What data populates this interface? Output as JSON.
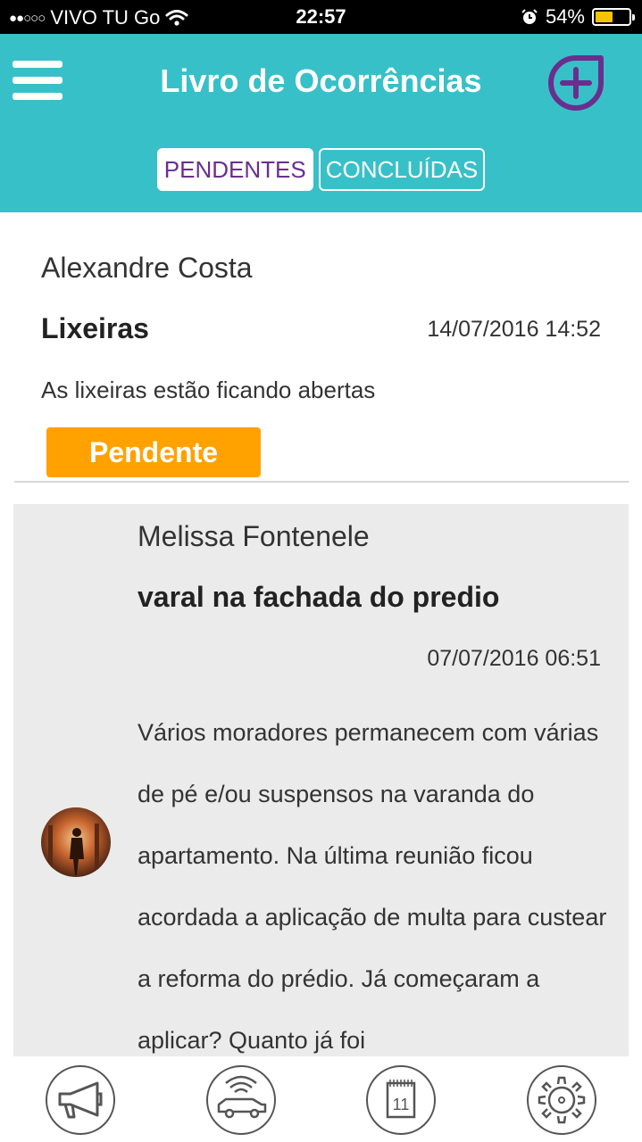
{
  "status_bar": {
    "signal": "●●○○○",
    "carrier": "VIVO TU Go",
    "time": "22:57",
    "battery_percent": "54%",
    "battery_level": 0.54
  },
  "header": {
    "title": "Livro de Ocorrências",
    "tabs": [
      {
        "label": "PENDENTES",
        "active": true
      },
      {
        "label": "CONCLUÍDAS",
        "active": false
      }
    ]
  },
  "occurrences": [
    {
      "author": "Alexandre Costa",
      "subject": "Lixeiras",
      "datetime": "14/07/2016 14:52",
      "description": "As lixeiras estão ficando abertas",
      "status": "Pendente"
    },
    {
      "author": "Melissa Fontenele",
      "subject": "varal na fachada do predio",
      "datetime": "07/07/2016 06:51",
      "description": "Vários moradores permanecem com várias de pé e/ou suspensos na varanda do apartamento. Na última reunião ficou acordada a aplicação de multa para custear a reforma do prédio. Já começaram a aplicar? Quanto já foi"
    }
  ],
  "bottom_nav": {
    "calendar_day": "11",
    "items": [
      "megaphone-icon",
      "car-wifi-icon",
      "calendar-icon",
      "gear-icon"
    ]
  },
  "colors": {
    "header": "#38c0c8",
    "accent_purple": "#6a2f8e",
    "pending": "#ffa200"
  }
}
